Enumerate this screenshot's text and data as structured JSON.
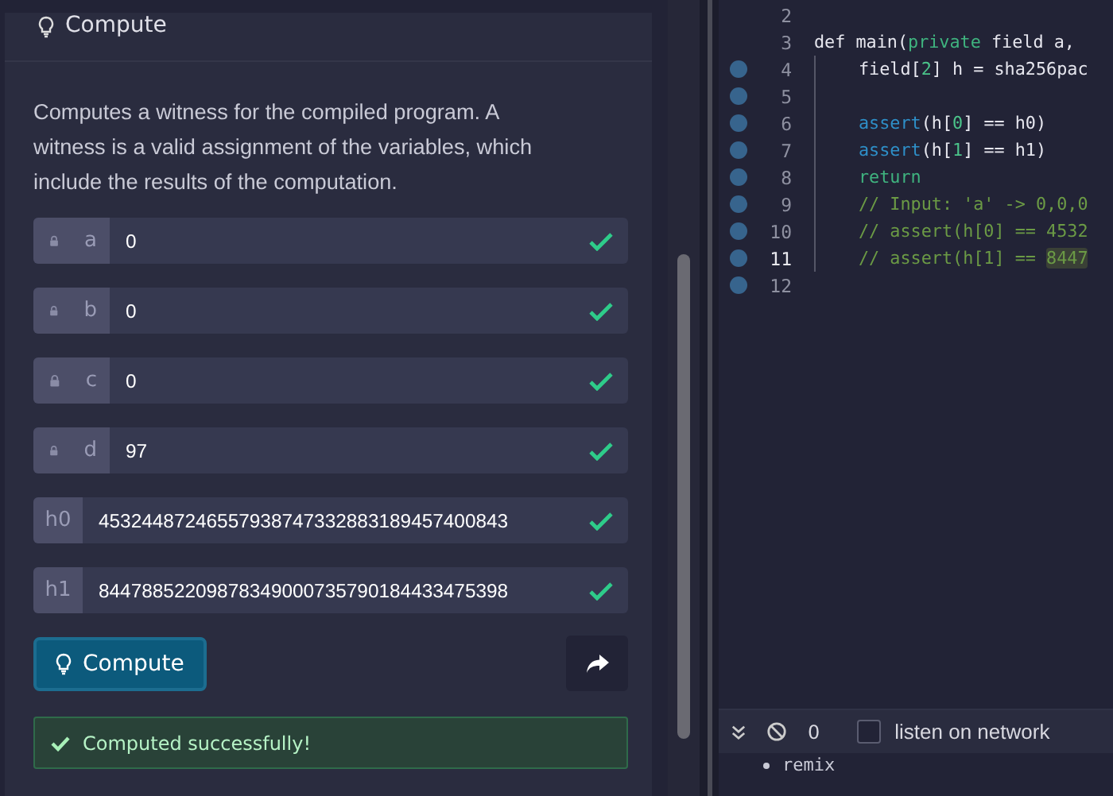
{
  "panel": {
    "title": "Compute",
    "description": "Computes a witness for the compiled program. A witness is a valid assignment of the variables, which include the results of the computation.",
    "fields": [
      {
        "label": "a",
        "value": "0",
        "locked": true,
        "valid": true
      },
      {
        "label": "b",
        "value": "0",
        "locked": true,
        "valid": true
      },
      {
        "label": "c",
        "value": "0",
        "locked": true,
        "valid": true
      },
      {
        "label": "d",
        "value": "97",
        "locked": true,
        "valid": true
      },
      {
        "label": "h0",
        "value": "45324487246557938747332883189457400843",
        "locked": false,
        "valid": true
      },
      {
        "label": "h1",
        "value": "84478852209878349000735790184433475398",
        "locked": false,
        "valid": true
      }
    ],
    "compute_button": "Compute",
    "status": {
      "kind": "success",
      "text": "Computed successfully!"
    }
  },
  "editor": {
    "lines": [
      {
        "number": "2",
        "breakpoint": false,
        "current": false
      },
      {
        "number": "3",
        "breakpoint": false,
        "current": false,
        "indent": false,
        "tokens": [
          {
            "text": "def main(",
            "kind": "plain"
          },
          {
            "text": "private",
            "kind": "keyword"
          },
          {
            "text": " field a,",
            "kind": "plain"
          }
        ]
      },
      {
        "number": "4",
        "breakpoint": true,
        "current": false,
        "indent": true,
        "tokens": [
          {
            "text": "field[",
            "kind": "plain"
          },
          {
            "text": "2",
            "kind": "number"
          },
          {
            "text": "] h = sha256pac",
            "kind": "plain"
          }
        ]
      },
      {
        "number": "5",
        "breakpoint": true,
        "current": false
      },
      {
        "number": "6",
        "breakpoint": true,
        "current": false,
        "indent": true,
        "tokens": [
          {
            "text": "assert",
            "kind": "builtin"
          },
          {
            "text": "(h[",
            "kind": "plain"
          },
          {
            "text": "0",
            "kind": "number"
          },
          {
            "text": "] == h0)",
            "kind": "plain"
          }
        ]
      },
      {
        "number": "7",
        "breakpoint": true,
        "current": false,
        "indent": true,
        "tokens": [
          {
            "text": "assert",
            "kind": "builtin"
          },
          {
            "text": "(h[",
            "kind": "plain"
          },
          {
            "text": "1",
            "kind": "number"
          },
          {
            "text": "] == h1)",
            "kind": "plain"
          }
        ]
      },
      {
        "number": "8",
        "breakpoint": true,
        "current": false,
        "indent": true,
        "tokens": [
          {
            "text": "return",
            "kind": "keyword"
          }
        ]
      },
      {
        "number": "9",
        "breakpoint": true,
        "current": false,
        "indent": true,
        "tokens": [
          {
            "text": "// Input: 'a' -> 0,0,0",
            "kind": "comment"
          }
        ]
      },
      {
        "number": "10",
        "breakpoint": true,
        "current": false,
        "indent": true,
        "tokens": [
          {
            "text": "// assert(h[0] == 4532",
            "kind": "comment"
          }
        ]
      },
      {
        "number": "11",
        "breakpoint": true,
        "current": true,
        "indent": true,
        "tokens": [
          {
            "text": "// assert(h[1] == ",
            "kind": "comment"
          },
          {
            "text": "8447",
            "kind": "highlight"
          }
        ]
      },
      {
        "number": "12",
        "breakpoint": true,
        "current": false
      }
    ]
  },
  "terminal": {
    "count": "0",
    "listen_on_network": false,
    "listen_label": "listen on network",
    "items": [
      "remix"
    ]
  }
}
